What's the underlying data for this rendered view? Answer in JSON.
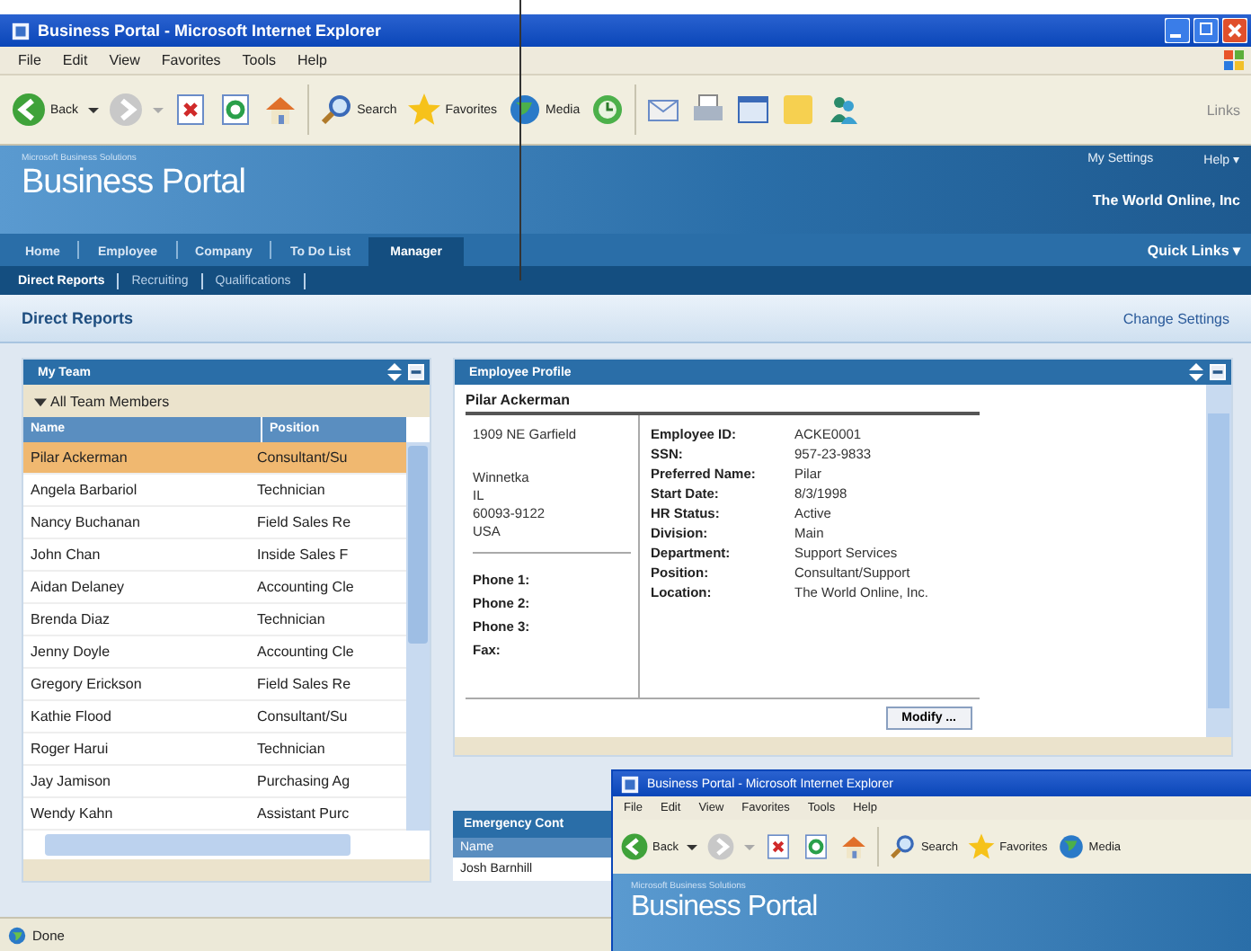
{
  "window": {
    "title": "Business Portal - Microsoft Internet Explorer"
  },
  "menu": [
    "File",
    "Edit",
    "View",
    "Favorites",
    "Tools",
    "Help"
  ],
  "toolbar": {
    "back": "Back",
    "search": "Search",
    "favorites": "Favorites",
    "media": "Media",
    "links": "Links"
  },
  "portal": {
    "brand_small": "Microsoft Business Solutions",
    "brand": "Business Portal",
    "links": [
      "My Settings",
      "Help ▾"
    ],
    "company": "The World Online, Inc",
    "quick_links": "Quick Links ▾"
  },
  "tabs": [
    {
      "label": "Home",
      "selected": false
    },
    {
      "label": "Employee",
      "selected": false
    },
    {
      "label": "Company",
      "selected": false
    },
    {
      "label": "To Do List",
      "selected": false
    },
    {
      "label": "Manager",
      "selected": true
    }
  ],
  "subnav": [
    {
      "label": "Direct Reports",
      "selected": true
    },
    {
      "label": "Recruiting",
      "selected": false
    },
    {
      "label": "Qualifications",
      "selected": false
    }
  ],
  "page": {
    "title": "Direct Reports",
    "settings_link": "Change Settings"
  },
  "team": {
    "title": "My Team",
    "group": "All Team Members",
    "expanded": true,
    "columns": [
      "Name",
      "Position"
    ],
    "rows": [
      {
        "name": "Pilar Ackerman",
        "position": "Consultant/Su",
        "selected": true
      },
      {
        "name": "Angela Barbariol",
        "position": "Technician",
        "selected": false
      },
      {
        "name": "Nancy Buchanan",
        "position": "Field Sales Re",
        "selected": false
      },
      {
        "name": "John Chan",
        "position": "Inside Sales F",
        "selected": false
      },
      {
        "name": "Aidan Delaney",
        "position": "Accounting Cle",
        "selected": false
      },
      {
        "name": "Brenda Diaz",
        "position": "Technician",
        "selected": false
      },
      {
        "name": "Jenny Doyle",
        "position": "Accounting Cle",
        "selected": false
      },
      {
        "name": "Gregory Erickson",
        "position": "Field Sales Re",
        "selected": false
      },
      {
        "name": "Kathie Flood",
        "position": "Consultant/Su",
        "selected": false
      },
      {
        "name": "Roger Harui",
        "position": "Technician",
        "selected": false
      },
      {
        "name": "Jay Jamison",
        "position": "Purchasing Ag",
        "selected": false
      },
      {
        "name": "Wendy Kahn",
        "position": "Assistant Purc",
        "selected": false
      }
    ]
  },
  "profile": {
    "title": "Employee Profile",
    "name": "Pilar Ackerman",
    "street": "1909 NE Garfield",
    "address": [
      "Winnetka",
      "IL",
      "60093-9122",
      "USA"
    ],
    "phones": [
      "Phone 1:",
      "Phone 2:",
      "Phone 3:",
      "Fax:"
    ],
    "fields": [
      {
        "label": "Employee ID:",
        "value": "ACKE0001"
      },
      {
        "label": "SSN:",
        "value": "957-23-9833"
      },
      {
        "label": "Preferred Name:",
        "value": "Pilar"
      },
      {
        "label": "Start Date:",
        "value": "8/3/1998"
      },
      {
        "label": "HR Status:",
        "value": "Active"
      },
      {
        "label": "Division:",
        "value": "Main"
      },
      {
        "label": "Department:",
        "value": "Support Services"
      },
      {
        "label": "Position:",
        "value": "Consultant/Support"
      },
      {
        "label": "Location:",
        "value": "The World Online, Inc."
      }
    ],
    "button": "Modify ..."
  },
  "emergency": {
    "title": "Emergency Cont",
    "columns": [
      "Name"
    ],
    "rows": [
      "Josh Barnhill"
    ]
  },
  "status": "Done",
  "overlay": {
    "title": "Business Portal - Microsoft Internet Explorer",
    "menu": [
      "File",
      "Edit",
      "View",
      "Favorites",
      "Tools",
      "Help"
    ],
    "toolbar": {
      "back": "Back",
      "search": "Search",
      "favorites": "Favorites",
      "media": "Media"
    },
    "brand_small": "Microsoft Business Solutions",
    "brand": "Business Portal"
  }
}
